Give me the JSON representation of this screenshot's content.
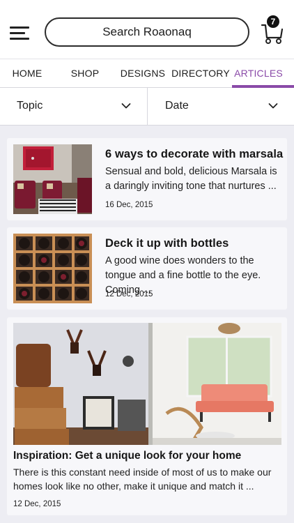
{
  "header": {
    "search_placeholder": "Search Roaonaq",
    "cart_count": "7"
  },
  "tabs": [
    {
      "label": "HOME",
      "active": false
    },
    {
      "label": "SHOP",
      "active": false
    },
    {
      "label": "DESIGNS",
      "active": false
    },
    {
      "label": "DIRECTORY",
      "active": false
    },
    {
      "label": "ARTICLES",
      "active": true
    }
  ],
  "filters": {
    "topic_label": "Topic",
    "date_label": "Date"
  },
  "articles": [
    {
      "title": "6 ways to decorate with marsala",
      "excerpt": "Sensual and bold, delicious Marsala is a daringly inviting tone that nurtures ...",
      "date": "16 Dec, 2015"
    },
    {
      "title": "Deck it up with bottles",
      "excerpt": "A good wine does wonders to the tongue and a fine bottle to the eye. Coming ...",
      "date": "12 Dec, 2015"
    },
    {
      "title": "Inspiration: Get a unique look for your home",
      "excerpt": "There is this constant need inside of most of us to make our homes look like no other, make it unique and match it ...",
      "date": "12 Dec, 2015"
    }
  ],
  "colors": {
    "accent": "#8a4aa8",
    "background": "#ededf3",
    "card": "#f7f7fa"
  },
  "icons": {
    "menu": "hamburger-menu-icon",
    "cart": "cart-icon",
    "chevron": "chevron-down-icon"
  }
}
